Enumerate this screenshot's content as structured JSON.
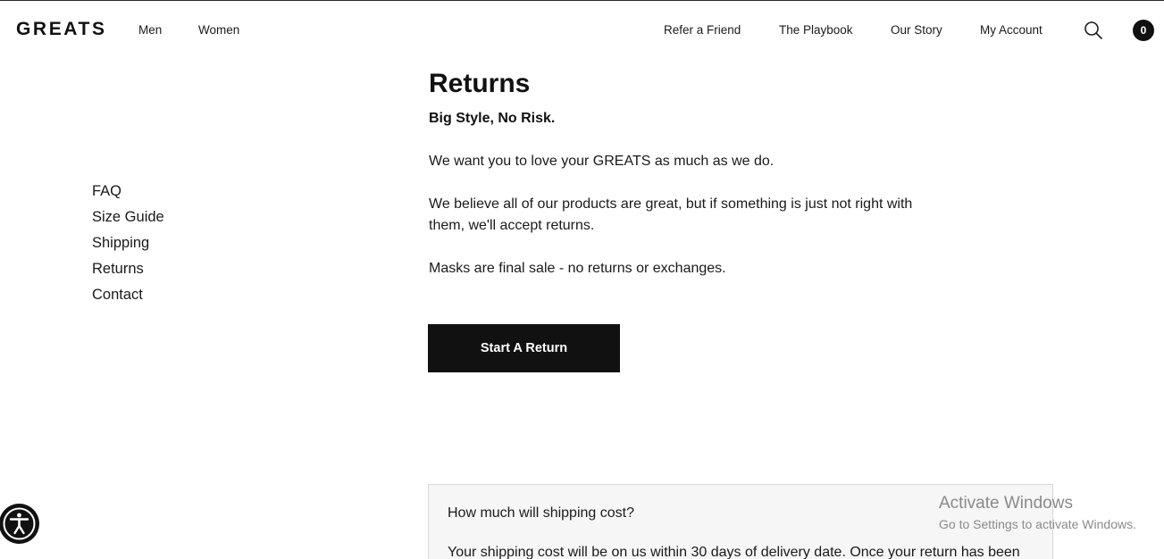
{
  "header": {
    "logo": "GREATS",
    "nav_left": [
      {
        "label": "Men"
      },
      {
        "label": "Women"
      }
    ],
    "nav_right": [
      {
        "label": "Refer a Friend"
      },
      {
        "label": "The Playbook"
      },
      {
        "label": "Our Story"
      },
      {
        "label": "My Account"
      }
    ],
    "search_icon": "search-icon",
    "cart_count": "0"
  },
  "sidebar": {
    "items": [
      {
        "label": "FAQ"
      },
      {
        "label": "Size Guide"
      },
      {
        "label": "Shipping"
      },
      {
        "label": "Returns"
      },
      {
        "label": "Contact"
      }
    ]
  },
  "main": {
    "title": "Returns",
    "subtitle": "Big Style, No Risk.",
    "paragraphs": [
      "We want you to love your GREATS as much as we do.",
      "We believe all of our products are great, but if something is just not right with them, we'll accept returns.",
      "Masks are final sale - no returns or exchanges."
    ],
    "cta_label": "Start A Return"
  },
  "faq": {
    "question": "How much will shipping cost?",
    "answer": "Your shipping cost will be on us within 30 days of delivery date. Once your return has been"
  },
  "accessibility": {
    "icon": "accessibility-icon"
  },
  "watermark": {
    "title": "Activate Windows",
    "subtitle": "Go to Settings to activate Windows."
  },
  "colors": {
    "primary": "#111111",
    "text": "#1a1a1a",
    "panel_bg": "#f6f6f6",
    "watermark": "#8a8a8a"
  }
}
